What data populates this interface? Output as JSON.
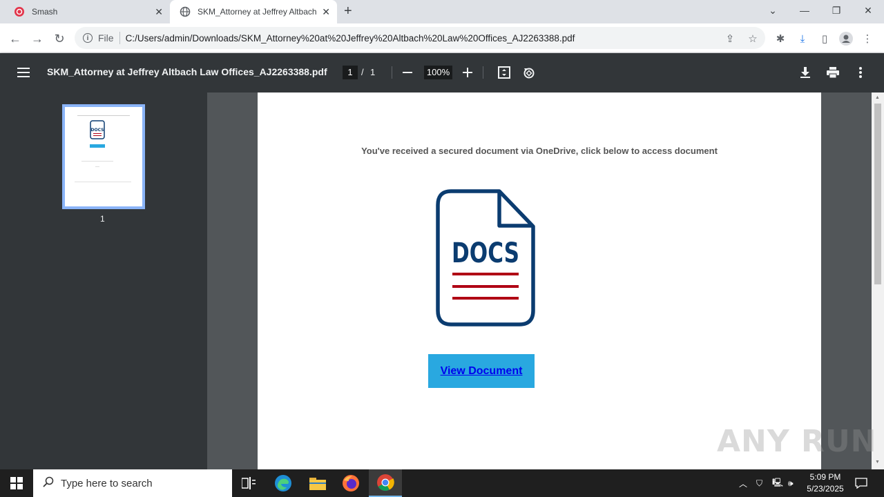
{
  "browser": {
    "tabs": [
      {
        "title": "Smash",
        "favicon": "smash-icon"
      },
      {
        "title": "SKM_Attorney at Jeffrey Altbach",
        "favicon": "globe-icon"
      }
    ],
    "url_scheme": "File",
    "url": "C:/Users/admin/Downloads/SKM_Attorney%20at%20Jeffrey%20Altbach%20Law%20Offices_AJ2263388.pdf"
  },
  "pdf_viewer": {
    "title": "SKM_Attorney at Jeffrey Altbach Law Offices_AJ2263388.pdf",
    "current_page": "1",
    "page_separator": "/",
    "total_pages": "1",
    "zoom": "100%",
    "thumbnail_label": "1"
  },
  "document": {
    "message": "You've received a secured document via OneDrive, click below to access document",
    "icon_text": "DOCS",
    "button_label": "View Document",
    "colors": {
      "icon_blue": "#0b3c70",
      "lines_red": "#b00014",
      "button_bg": "#29a8e0"
    }
  },
  "watermark": "ANY RUN",
  "taskbar": {
    "search_placeholder": "Type here to search",
    "time": "5:09 PM",
    "date": "5/23/2025"
  }
}
